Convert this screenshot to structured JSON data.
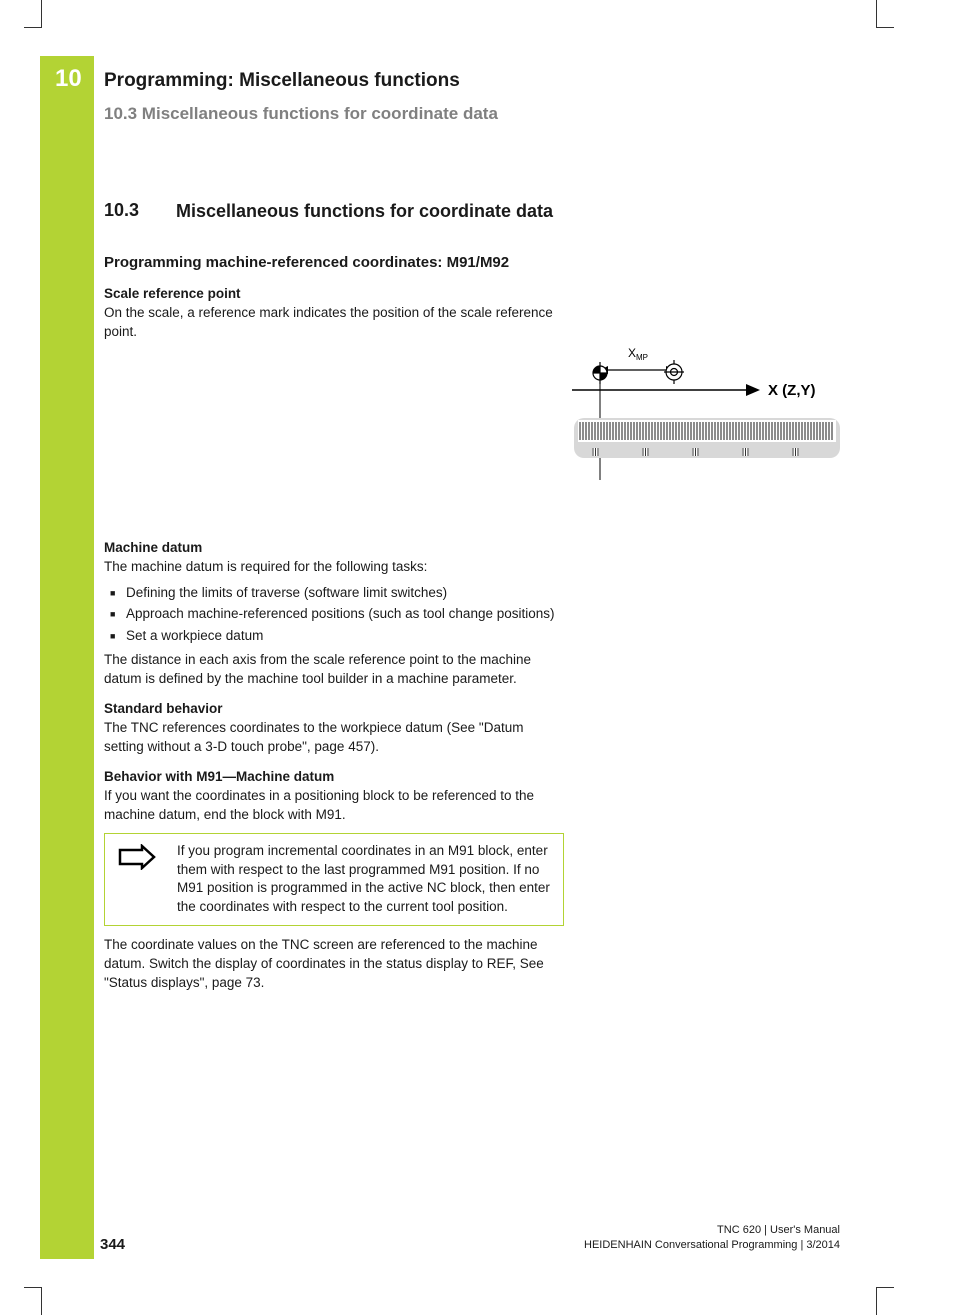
{
  "chapter_number": "10",
  "chapter_title": "Programming: Miscellaneous functions",
  "section_header": "10.3   Miscellaneous functions for coordinate data",
  "section": {
    "num": "10.3",
    "title": "Miscellaneous functions for coordinate data"
  },
  "subheading": "Programming machine-referenced coordinates: M91/M92",
  "scale_ref": {
    "label": "Scale reference point",
    "text": "On the scale, a reference mark indicates the position of the scale reference point."
  },
  "figure": {
    "xmp_label": "X",
    "xmp_sub": "MP",
    "axis_label": "X (Z,Y)"
  },
  "machine_datum": {
    "label": "Machine datum",
    "intro": "The machine datum is required for the following tasks:",
    "bullets": [
      "Defining the limits of traverse (software limit switches)",
      "Approach machine-referenced positions (such as tool change positions)",
      "Set a workpiece datum"
    ],
    "after": "The distance in each axis from the scale reference point to the machine datum is defined by the machine tool builder in a machine parameter."
  },
  "standard": {
    "label": "Standard behavior",
    "text": "The TNC references coordinates to the workpiece datum (See \"Datum setting without a 3-D touch probe\", page 457)."
  },
  "m91": {
    "label": "Behavior with M91—Machine datum",
    "text": "If you want the coordinates in a positioning block to be referenced to the machine datum, end the block with M91.",
    "note": "If you program incremental coordinates in an M91 block, enter them with respect to the last programmed M91 position. If no M91 position is programmed in the active NC block, then enter the coordinates with respect to the current tool position.",
    "after": "The coordinate values on the TNC screen are referenced to the machine datum. Switch the display of coordinates in the status display to REF, See \"Status displays\", page 73."
  },
  "footer": {
    "page": "344",
    "line1": "TNC 620 | User's Manual",
    "line2": "HEIDENHAIN Conversational Programming | 3/2014"
  }
}
